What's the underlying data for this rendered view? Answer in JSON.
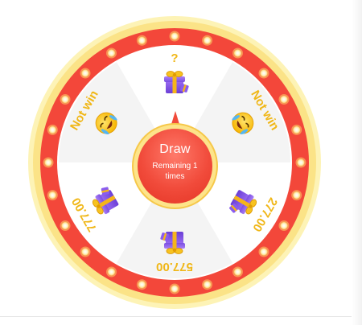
{
  "wheel": {
    "colors": {
      "outer_glow": "#fdf3b6",
      "outer_rim": "#fbe387",
      "red_ring": "#f3473a",
      "inner_rim": "#ffffff",
      "slice_light": "#ffffff",
      "slice_shade": "#f4f4f4",
      "prize_text": "#f0b718",
      "bulb": "#fff6d8",
      "bulb_glow": "#fcd26a"
    },
    "segments": [
      {
        "label": "?",
        "icon": "gift-box-icon"
      },
      {
        "label": "Not win",
        "icon": "crying-face-icon"
      },
      {
        "label": "277.00",
        "icon": "gift-box-icon"
      },
      {
        "label": "577.00",
        "icon": "gift-box-icon"
      },
      {
        "label": "777.00",
        "icon": "gift-box-icon"
      },
      {
        "label": "Not win",
        "icon": "crying-face-icon"
      }
    ]
  },
  "draw_button": {
    "label": "Draw",
    "remaining_text": "Remaining  1  times"
  }
}
